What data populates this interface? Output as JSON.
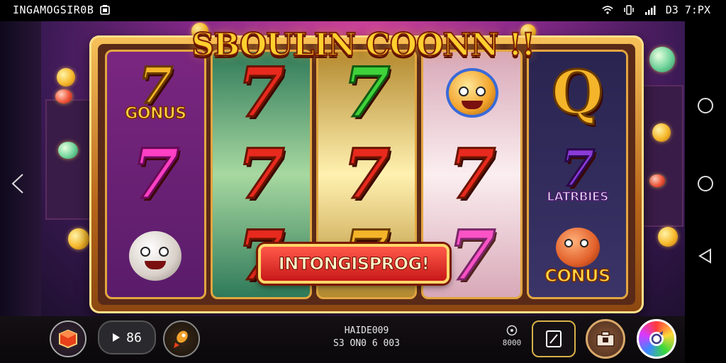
{
  "status_bar": {
    "left_text": "INGAMOGSIR0B",
    "right_text": "D3 7:PX"
  },
  "game": {
    "title": "SBOULIN COONN !!",
    "banner_text": "INTONGISPROG!",
    "reels": [
      {
        "symbols": [
          {
            "type": "seven-label",
            "label": "GONUS",
            "color": "gold"
          },
          {
            "type": "seven",
            "color": "pink"
          },
          {
            "type": "mascot",
            "name": "ghost-character"
          }
        ]
      },
      {
        "symbols": [
          {
            "type": "seven",
            "color": "red"
          },
          {
            "type": "seven",
            "color": "red"
          },
          {
            "type": "seven",
            "color": "red"
          }
        ]
      },
      {
        "symbols": [
          {
            "type": "seven",
            "color": "green"
          },
          {
            "type": "seven",
            "color": "red"
          },
          {
            "type": "seven",
            "color": "gold"
          }
        ]
      },
      {
        "symbols": [
          {
            "type": "mascot",
            "name": "coin-face-character"
          },
          {
            "type": "seven",
            "color": "red"
          },
          {
            "type": "seven",
            "color": "pink"
          }
        ]
      },
      {
        "symbols": [
          {
            "type": "letter",
            "text": "Q"
          },
          {
            "type": "seven-label",
            "label": "LATRBIES",
            "color": "gold"
          },
          {
            "type": "mascot-label",
            "label": "CONUS",
            "name": "bear-character"
          }
        ]
      }
    ]
  },
  "controls": {
    "bet_value": "86",
    "info_line1": "HAIDE009",
    "info_line2": "S3 ON0 6 003",
    "credits": "8000"
  }
}
